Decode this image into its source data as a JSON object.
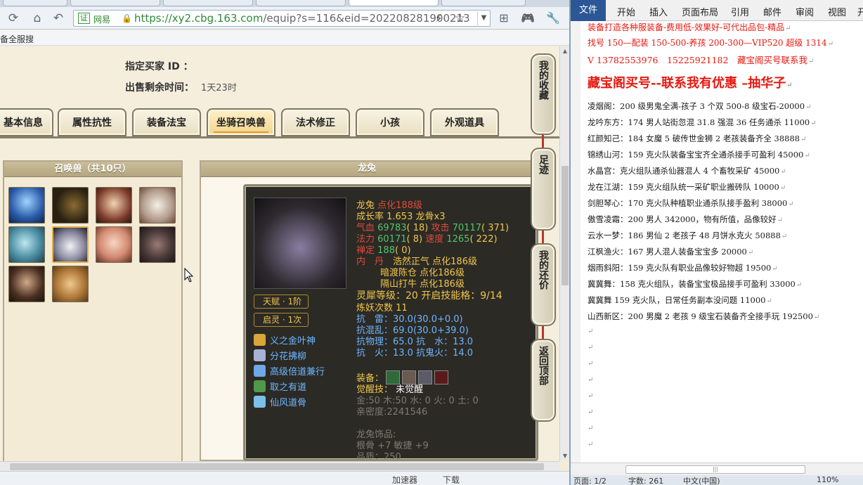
{
  "browser": {
    "site_name": "网易",
    "cert_label": "证",
    "url": "https://xy2.cbg.163.com",
    "url_extra": "/equip?s=116&eid=202208281900213",
    "bookmark": "备全服搜",
    "status_items": [
      "加速器",
      "下载"
    ]
  },
  "page": {
    "buyer_id_label": "指定买家 ID ：",
    "time_left_label": "出售剩余时间：",
    "time_left_value": "1天23时",
    "tabs": [
      "基本信息",
      "属性抗性",
      "装备法宝",
      "坐骑召唤兽",
      "法术修正",
      "小孩",
      "外观道具"
    ],
    "active_tab": "坐骑召唤兽",
    "pet_panel_title": "召唤兽（共10只）",
    "detail_title": "龙兔",
    "sidebar": [
      "我的收藏",
      "足迹",
      "我的还价",
      "返回顶部"
    ]
  },
  "pet": {
    "name": "龙兔",
    "awaken": "点化188级",
    "growth": "成长率 1.653",
    "bone": "龙骨x3",
    "hp_label": "气血",
    "hp": "69783",
    "hp_add": "( 18)",
    "atk_label": "攻击",
    "atk": "70117",
    "atk_add": "( 371)",
    "mp_label": "法力",
    "mp": "60171",
    "mp_add": "( 8)",
    "spd_label": "速度",
    "spd": "1265",
    "spd_add": "( 222)",
    "zen_label": "禅定",
    "zen": "188",
    "zen_add": "( 0)",
    "neidan_label": "内　丹",
    "neidan": [
      "浩然正气 点化186级",
      "暗渡陈仓 点化186级",
      "隔山打牛 点化186级"
    ],
    "lingxi": "灵犀等级：20 开启技能格：9/14",
    "lianyao": "炼妖次数 11",
    "res_lei": "抗　雷：30.0(30.0+0.0)",
    "res_hun": "抗混乱：69.0(30.0+39.0)",
    "res_wuli": "抗物理：65.0 抗　水：13.0",
    "res_huo": "抗　火：13.0 抗鬼火：14.0",
    "equip_label": "装备：",
    "juexing_label": "觉醒技：",
    "juexing": "未觉醒",
    "elements": "金:50 木:50 水: 0 火: 0 土: 0",
    "intimacy": "亲密度:2241546",
    "ornament_title": "龙兔饰品:",
    "ornament": "根骨 +7 敏捷 +9",
    "quality": "品质：250",
    "badges": [
      "天赋 · 1阶",
      "启灵 · 1次"
    ],
    "skills": [
      "义之金叶神",
      "分花拂柳",
      "高级倍道兼行",
      "取之有道",
      "仙风道骨"
    ]
  },
  "word": {
    "ribbon_tabs": [
      "文件",
      "开始",
      "插入",
      "页面布局",
      "引用",
      "邮件",
      "审阅",
      "视图",
      "开"
    ],
    "lines_red": [
      "装备打造各种服装备-费用低-效果好-可代出品包-精品",
      "找号 150—配装 150-500-养孩 200-300—VIP520 超级 1314",
      "V 13782553976　15225921182　藏宝阁买号联系我"
    ],
    "headline": "藏宝阁买号--联系我有优惠 –抽华子",
    "lines": [
      "凌烟阁：200 级男鬼全满-孩子 3 个双 500-8 级宝石-20000",
      "龙吟东方：174 男人站街忽混 31.8 强混 36 任务通杀 11000",
      "红颜知己：184 女魔 5 破传世金狮 2 老孩装备齐全 38888",
      "锦绣山河：159 克火队装备宝宝齐全通杀接手可盈利 45000",
      "水晶宫：克火组队通杀仙器混人 4 个畜牧采矿 45000",
      "龙在江湖：159 克火组队统一采矿职业搬砖队 10000",
      "剑胆琴心：170 克火队种植职业通杀队接手盈利 38000",
      "傲雪凌霜：200 男人 342000，物有所值，品像较好",
      "云水一梦：186 男仙 2 老孩子 48 月饼水克火 50888",
      "江枫渔火：167 男人混人装备宝宝多 20000",
      "烟雨斜阳：159 克火队有职业品像较好物超 19500",
      "冀冀舞：158 克火组队，装备宝宝极品接手可盈利 33000",
      "冀冀舞 159 克火队，日常任务副本没问题 11000",
      "山西新区：200 男魔 2 老孩 9 级宝石装备齐全接手玩 192500"
    ],
    "status": [
      "页面: 1/2",
      "字数: 261",
      "中文(中国)",
      "110%"
    ]
  }
}
